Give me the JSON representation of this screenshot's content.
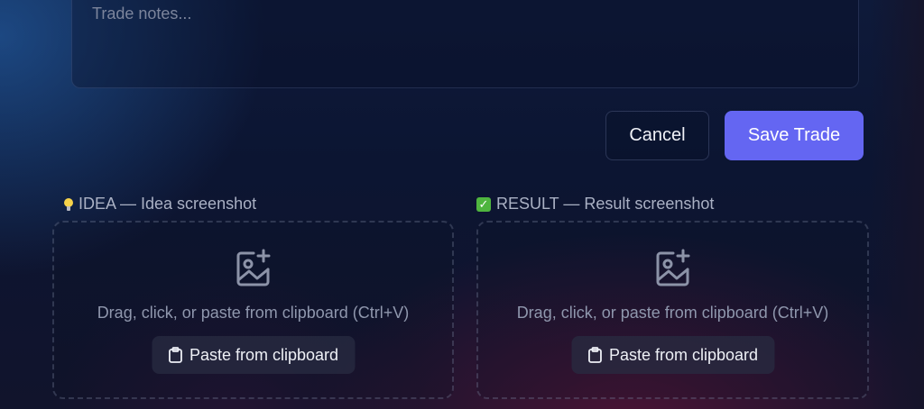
{
  "notes": {
    "placeholder": "Trade notes..."
  },
  "actions": {
    "cancel_label": "Cancel",
    "save_label": "Save Trade"
  },
  "uploads": [
    {
      "label_emoji": "bulb",
      "label": "IDEA — Idea screenshot",
      "hint": "Drag, click, or paste from clipboard (Ctrl+V)",
      "paste_label": "Paste from clipboard",
      "icon": "image-plus-icon"
    },
    {
      "label_emoji": "check-mark-button",
      "label": "RESULT — Result screenshot",
      "hint": "Drag, click, or paste from clipboard (Ctrl+V)",
      "paste_label": "Paste from clipboard",
      "icon": "image-plus-icon"
    }
  ],
  "colors": {
    "accent": "#6466f2",
    "check": "#4fb53f",
    "bulb": "#f6d24a"
  }
}
